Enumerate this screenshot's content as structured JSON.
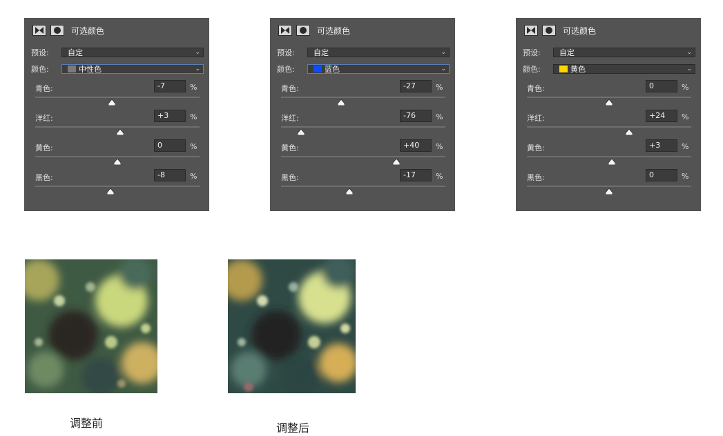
{
  "panels": [
    {
      "title": "可选颜色",
      "preset_label": "预设:",
      "preset_value": "自定",
      "color_label": "颜色:",
      "color_value": "中性色",
      "swatch": "#7b7b7b",
      "sliders": [
        {
          "label": "青色:",
          "value": "-7",
          "unit": "%",
          "level": -7
        },
        {
          "label": "洋红:",
          "value": "+3",
          "unit": "%",
          "level": 3
        },
        {
          "label": "黄色:",
          "value": "0",
          "unit": "%",
          "level": 0
        },
        {
          "label": "黑色:",
          "value": "-8",
          "unit": "%",
          "level": -8
        }
      ]
    },
    {
      "title": "可选颜色",
      "preset_label": "预设:",
      "preset_value": "自定",
      "color_label": "颜色:",
      "color_value": "蓝色",
      "swatch": "#0a4dff",
      "sliders": [
        {
          "label": "青色:",
          "value": "-27",
          "unit": "%",
          "level": -27
        },
        {
          "label": "洋红:",
          "value": "-76",
          "unit": "%",
          "level": -76
        },
        {
          "label": "黄色:",
          "value": "+40",
          "unit": "%",
          "level": 40
        },
        {
          "label": "黑色:",
          "value": "-17",
          "unit": "%",
          "level": -17
        }
      ]
    },
    {
      "title": "可选颜色",
      "preset_label": "预设:",
      "preset_value": "自定",
      "color_label": "颜色:",
      "color_value": "黄色",
      "swatch": "#ffd400",
      "sliders": [
        {
          "label": "青色:",
          "value": "0",
          "unit": "%",
          "level": 0
        },
        {
          "label": "洋红:",
          "value": "+24",
          "unit": "%",
          "level": 24
        },
        {
          "label": "黄色:",
          "value": "+3",
          "unit": "%",
          "level": 3
        },
        {
          "label": "黑色:",
          "value": "0",
          "unit": "%",
          "level": 0
        }
      ]
    }
  ],
  "captions": {
    "before": "调整前",
    "after": "调整后"
  },
  "colors": {
    "panel_bg": "#535353",
    "field_bg": "#3b3b3b",
    "active_border": "#5a7fb5"
  },
  "icons": [
    "mask-icon",
    "circle-mask-icon",
    "chevron-down-icon",
    "slider-thumb-icon"
  ]
}
